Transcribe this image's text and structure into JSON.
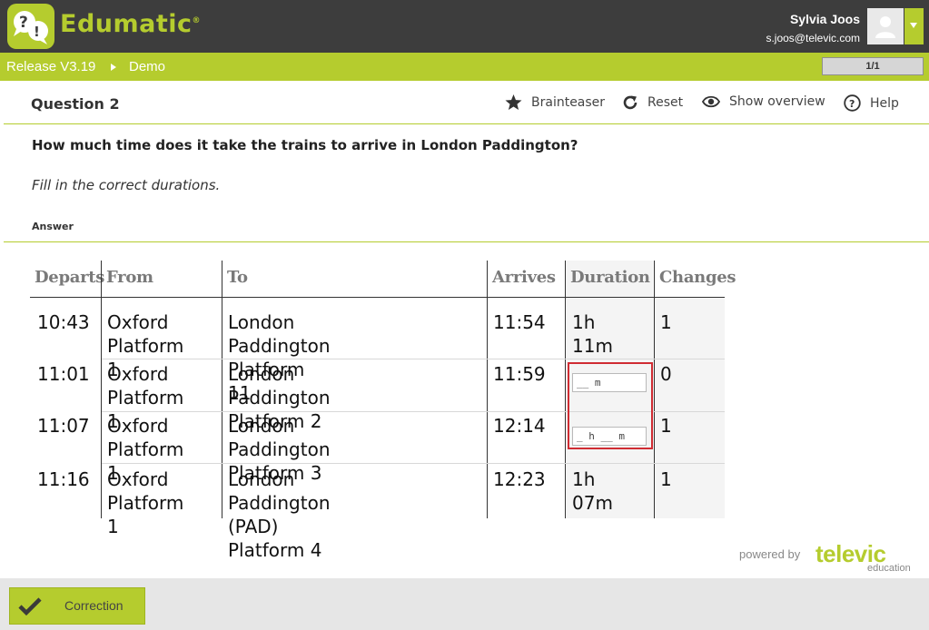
{
  "app": {
    "brand": "Edumatic",
    "brand_mark": "®",
    "logo_icon": "question-bubbles-icon"
  },
  "user": {
    "name": "Sylvia Joos",
    "email": "s.joos@televic.com"
  },
  "breadcrumb": {
    "release": "Release V3.19",
    "project": "Demo",
    "pager": "1/1"
  },
  "question": {
    "title": "Question 2",
    "text": "How much time does it take the trains to arrive in London Paddington?",
    "instruction": "Fill in the correct durations.",
    "answer_label": "Answer"
  },
  "toolbar": {
    "brainteaser": "Brainteaser",
    "reset": "Reset",
    "show_overview": "Show overview",
    "help": "Help"
  },
  "timetable": {
    "headers": [
      "Departs",
      "From",
      "To",
      "Arrives",
      "Duration",
      "Changes"
    ],
    "rows": [
      {
        "departs": "10:43",
        "from1": "Oxford",
        "from2": "Platform 1",
        "to1": "London Paddington",
        "to2": "Platform 11",
        "arrives": "11:54",
        "duration": "1h 11m",
        "changes": "1"
      },
      {
        "departs": "11:01",
        "from1": "Oxford",
        "from2": "Platform 1",
        "to1": "London Paddington",
        "to2": "Platform 2",
        "arrives": "11:59",
        "duration_input": "__ m",
        "changes": "0"
      },
      {
        "departs": "11:07",
        "from1": "Oxford",
        "from2": "Platform 1",
        "to1": "London Paddington",
        "to2": "Platform 3",
        "arrives": "12:14",
        "duration_input": "_ h __ m",
        "changes": "1"
      },
      {
        "departs": "11:16",
        "from1": "Oxford",
        "from2": "Platform 1",
        "to1": "London Paddington (PAD)",
        "to2": "Platform 4",
        "arrives": "12:23",
        "duration": "1h 07m",
        "changes": "1"
      }
    ]
  },
  "footer": {
    "powered_by": "powered by",
    "vendor": "televic",
    "vendor_sub": "education",
    "correction_button": "Correction"
  },
  "colors": {
    "accent": "#b5cc2e",
    "topbar": "#3d3d3d",
    "error_outline": "#d02c33"
  }
}
